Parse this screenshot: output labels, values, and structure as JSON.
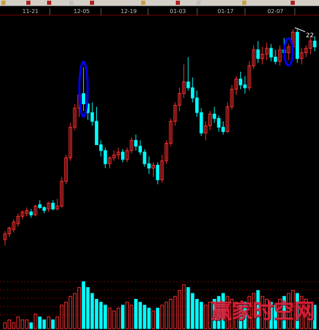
{
  "toolbar": {
    "icons": [
      "chart-tool-icon",
      "draw-icon",
      "zoom-icon",
      "percent-icon",
      "number-icon",
      "indicator-icon",
      "line-icon",
      "zoom-in-icon",
      "zoom-out-icon",
      "arrow-icon"
    ]
  },
  "watermark": {
    "text": "赢家时空网"
  },
  "colors": {
    "up": "#ff3030",
    "down": "#00ffff",
    "ellipse": "#0000ff",
    "grid": "#800000",
    "background": "#000000",
    "axis_text": "#c0c0c0"
  },
  "chart_data": {
    "type": "candlestick",
    "x_tick_labels": [
      "11-21",
      "12-05",
      "12-19",
      "01-03",
      "01-17",
      "02-07"
    ],
    "price_label": "22.",
    "candles": [
      {
        "o": 8.2,
        "h": 8.8,
        "l": 7.8,
        "c": 8.6
      },
      {
        "o": 8.6,
        "h": 9.1,
        "l": 8.4,
        "c": 9.0
      },
      {
        "o": 8.9,
        "h": 9.6,
        "l": 8.7,
        "c": 9.4
      },
      {
        "o": 9.3,
        "h": 10.0,
        "l": 9.1,
        "c": 9.8
      },
      {
        "o": 9.8,
        "h": 10.2,
        "l": 9.6,
        "c": 10.1
      },
      {
        "o": 10.0,
        "h": 10.4,
        "l": 9.8,
        "c": 10.2
      },
      {
        "o": 10.1,
        "h": 10.3,
        "l": 9.7,
        "c": 9.9
      },
      {
        "o": 9.9,
        "h": 10.6,
        "l": 9.8,
        "c": 10.5
      },
      {
        "o": 10.6,
        "h": 10.9,
        "l": 10.3,
        "c": 10.4
      },
      {
        "o": 10.4,
        "h": 10.5,
        "l": 10.0,
        "c": 10.2
      },
      {
        "o": 10.3,
        "h": 10.8,
        "l": 10.1,
        "c": 10.7
      },
      {
        "o": 10.7,
        "h": 10.9,
        "l": 10.2,
        "c": 10.3
      },
      {
        "o": 10.3,
        "h": 11.0,
        "l": 10.2,
        "c": 10.5
      },
      {
        "o": 10.5,
        "h": 12.5,
        "l": 10.4,
        "c": 12.2
      },
      {
        "o": 12.2,
        "h": 14.0,
        "l": 12.0,
        "c": 13.8
      },
      {
        "o": 13.8,
        "h": 16.2,
        "l": 13.6,
        "c": 15.9
      },
      {
        "o": 15.9,
        "h": 17.5,
        "l": 15.7,
        "c": 17.2
      },
      {
        "o": 17.2,
        "h": 18.4,
        "l": 16.6,
        "c": 18.1
      },
      {
        "o": 18.2,
        "h": 20.0,
        "l": 17.0,
        "c": 17.5
      },
      {
        "o": 17.5,
        "h": 18.1,
        "l": 16.4,
        "c": 16.9
      },
      {
        "o": 16.9,
        "h": 17.6,
        "l": 16.0,
        "c": 16.3
      },
      {
        "o": 16.3,
        "h": 17.3,
        "l": 15.2,
        "c": 14.7
      },
      {
        "o": 14.7,
        "h": 15.0,
        "l": 13.9,
        "c": 14.3
      },
      {
        "o": 14.3,
        "h": 14.5,
        "l": 13.1,
        "c": 13.4
      },
      {
        "o": 13.4,
        "h": 13.9,
        "l": 13.1,
        "c": 13.8
      },
      {
        "o": 13.8,
        "h": 14.3,
        "l": 13.6,
        "c": 14.0
      },
      {
        "o": 14.0,
        "h": 14.5,
        "l": 13.7,
        "c": 14.2
      },
      {
        "o": 14.2,
        "h": 14.4,
        "l": 13.5,
        "c": 13.7
      },
      {
        "o": 13.7,
        "h": 14.5,
        "l": 13.5,
        "c": 14.3
      },
      {
        "o": 14.3,
        "h": 15.2,
        "l": 14.1,
        "c": 15.0
      },
      {
        "o": 15.0,
        "h": 15.4,
        "l": 14.3,
        "c": 14.6
      },
      {
        "o": 14.6,
        "h": 15.0,
        "l": 14.0,
        "c": 14.2
      },
      {
        "o": 14.2,
        "h": 14.4,
        "l": 13.2,
        "c": 13.4
      },
      {
        "o": 13.4,
        "h": 13.9,
        "l": 12.7,
        "c": 13.1
      },
      {
        "o": 13.1,
        "h": 13.5,
        "l": 12.5,
        "c": 13.3
      },
      {
        "o": 13.3,
        "h": 13.5,
        "l": 12.0,
        "c": 12.3
      },
      {
        "o": 12.3,
        "h": 14.0,
        "l": 12.1,
        "c": 13.6
      },
      {
        "o": 13.6,
        "h": 15.0,
        "l": 13.4,
        "c": 14.8
      },
      {
        "o": 14.8,
        "h": 16.5,
        "l": 14.6,
        "c": 16.3
      },
      {
        "o": 16.3,
        "h": 17.6,
        "l": 16.0,
        "c": 17.4
      },
      {
        "o": 17.4,
        "h": 18.6,
        "l": 17.0,
        "c": 18.2
      },
      {
        "o": 18.2,
        "h": 20.2,
        "l": 17.9,
        "c": 19.0
      },
      {
        "o": 19.0,
        "h": 20.7,
        "l": 18.4,
        "c": 18.6
      },
      {
        "o": 18.6,
        "h": 19.3,
        "l": 17.6,
        "c": 17.9
      },
      {
        "o": 17.9,
        "h": 18.4,
        "l": 16.6,
        "c": 16.9
      },
      {
        "o": 16.9,
        "h": 17.2,
        "l": 15.3,
        "c": 15.5
      },
      {
        "o": 15.5,
        "h": 16.3,
        "l": 15.0,
        "c": 16.0
      },
      {
        "o": 16.0,
        "h": 17.0,
        "l": 15.7,
        "c": 16.8
      },
      {
        "o": 16.8,
        "h": 17.3,
        "l": 16.2,
        "c": 16.5
      },
      {
        "o": 16.5,
        "h": 16.7,
        "l": 15.6,
        "c": 15.9
      },
      {
        "o": 15.9,
        "h": 16.3,
        "l": 15.4,
        "c": 15.6
      },
      {
        "o": 15.6,
        "h": 17.6,
        "l": 15.5,
        "c": 17.3
      },
      {
        "o": 17.3,
        "h": 18.8,
        "l": 17.1,
        "c": 18.5
      },
      {
        "o": 18.5,
        "h": 19.4,
        "l": 18.1,
        "c": 19.2
      },
      {
        "o": 19.2,
        "h": 19.7,
        "l": 18.5,
        "c": 18.8
      },
      {
        "o": 18.8,
        "h": 19.4,
        "l": 18.2,
        "c": 18.6
      },
      {
        "o": 18.6,
        "h": 20.4,
        "l": 18.4,
        "c": 20.1
      },
      {
        "o": 20.1,
        "h": 21.5,
        "l": 19.9,
        "c": 21.2
      },
      {
        "o": 21.2,
        "h": 21.8,
        "l": 20.3,
        "c": 20.6
      },
      {
        "o": 20.6,
        "h": 21.4,
        "l": 20.2,
        "c": 20.9
      },
      {
        "o": 20.9,
        "h": 21.7,
        "l": 20.5,
        "c": 21.3
      },
      {
        "o": 21.3,
        "h": 21.6,
        "l": 20.4,
        "c": 20.7
      },
      {
        "o": 20.7,
        "h": 21.2,
        "l": 20.2,
        "c": 20.4
      },
      {
        "o": 20.4,
        "h": 21.5,
        "l": 20.1,
        "c": 21.2
      },
      {
        "o": 21.2,
        "h": 22.0,
        "l": 20.7,
        "c": 21.0
      },
      {
        "o": 21.0,
        "h": 21.6,
        "l": 20.5,
        "c": 21.4
      },
      {
        "o": 21.4,
        "h": 22.6,
        "l": 21.1,
        "c": 22.4
      },
      {
        "o": 22.4,
        "h": 22.6,
        "l": 20.3,
        "c": 20.6
      },
      {
        "o": 20.6,
        "h": 21.3,
        "l": 20.2,
        "c": 21.0
      },
      {
        "o": 21.0,
        "h": 21.5,
        "l": 20.7,
        "c": 21.3
      },
      {
        "o": 21.3,
        "h": 22.0,
        "l": 20.9,
        "c": 21.8
      },
      {
        "o": 21.8,
        "h": 22.1,
        "l": 21.1,
        "c": 21.4
      }
    ],
    "volume": [
      2,
      3,
      2,
      4,
      3,
      3,
      2,
      5,
      4,
      3,
      4,
      3,
      4,
      8,
      9,
      11,
      12,
      14,
      16,
      14,
      12,
      10,
      9,
      8,
      7,
      6,
      7,
      8,
      9,
      8,
      10,
      9,
      8,
      7,
      6,
      7,
      8,
      9,
      10,
      11,
      13,
      15,
      14,
      12,
      10,
      9,
      8,
      9,
      10,
      11,
      12,
      11,
      10,
      9,
      8,
      9,
      11,
      12,
      13,
      11,
      10,
      9,
      8,
      10,
      11,
      12,
      13,
      12,
      11,
      10,
      9,
      8
    ],
    "highlight_ellipses": [
      {
        "candle": 18
      },
      {
        "candle": 65
      }
    ],
    "ylim": [
      7.5,
      23.0
    ],
    "grid": true
  }
}
